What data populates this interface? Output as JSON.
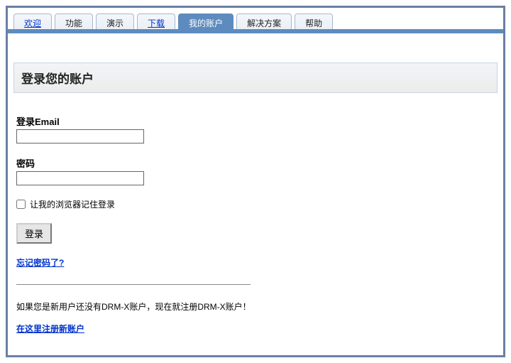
{
  "tabs": {
    "welcome": "欢迎",
    "features": "功能",
    "demo": "演示",
    "download": "下载",
    "account": "我的账户",
    "solutions": "解决方案",
    "help": "帮助"
  },
  "page": {
    "title": "登录您的账户"
  },
  "form": {
    "email_label": "登录Email",
    "password_label": "密码",
    "remember_label": "让我的浏览器记住登录",
    "login_button": "登录",
    "forgot_link": "忘记密码了?"
  },
  "register": {
    "info": "如果您是新用户还没有DRM-X账户，现在就注册DRM-X账户！",
    "link": "在这里注册新账户"
  }
}
